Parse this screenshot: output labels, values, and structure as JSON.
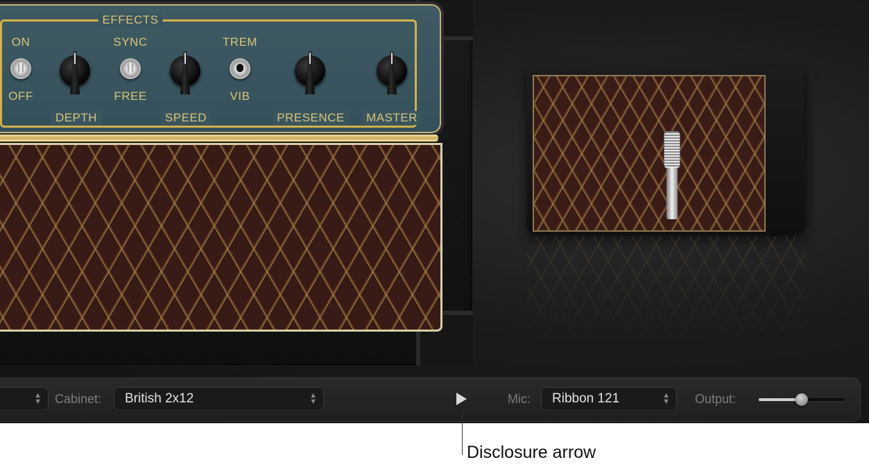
{
  "amp": {
    "section_title": "EFFECTS",
    "switch_labels": {
      "on": "ON",
      "off": "OFF",
      "sync": "SYNC",
      "free": "FREE",
      "trem": "TREM",
      "vib": "VIB"
    },
    "knob_labels": {
      "depth": "DEPTH",
      "speed": "SPEED",
      "presence": "PRESENCE",
      "master": "MASTER"
    }
  },
  "controls": {
    "cabinet_label": "Cabinet:",
    "cabinet_value": "British 2x12",
    "mic_label": "Mic:",
    "mic_value": "Ribbon 121",
    "output_label": "Output:",
    "output_level": 0.5,
    "updown_glyph": "▲\n▼"
  },
  "callout": {
    "text": "Disclosure arrow"
  },
  "colors": {
    "panel_text": "#d8c57a",
    "panel_bg": "#3a555e",
    "piping": "#d4b24a"
  }
}
